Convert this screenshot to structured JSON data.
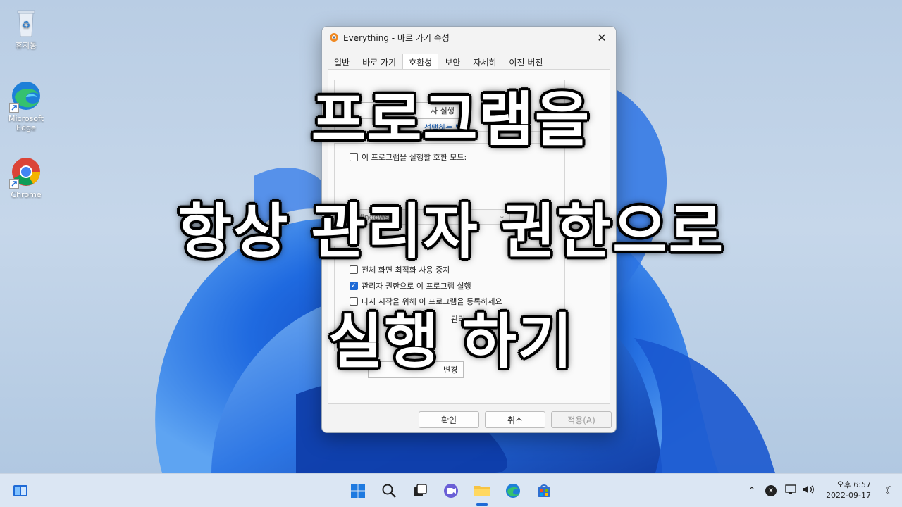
{
  "desktop": {
    "icons": [
      {
        "label": "휴지통",
        "icon": "recycle-bin-icon"
      },
      {
        "label": "Microsoft Edge",
        "icon": "edge-icon"
      },
      {
        "label": "Chrome",
        "icon": "chrome-icon"
      }
    ]
  },
  "dialog": {
    "title": "Everything - 바로 가기 속성",
    "tabs": [
      "일반",
      "바로 가기",
      "호환성",
      "보안",
      "자세히",
      "이전 버전"
    ],
    "active_tab": "호환성",
    "compat_button_fragment": "사 실행",
    "compat_link_fragment": "선택하는 방",
    "compat_mode_checkbox": "이 프로그램을 실행할 호환 모드:",
    "compat_mode_select": "Windows 8",
    "fullscreen_checkbox": "전체 화면 최적화 사용 중지",
    "admin_checkbox": "관리자 권한으로 이 프로그램 실행",
    "register_checkbox_fragment": "다시 시작을 위해 이 프로그램을 등록하세요",
    "management_fragment": "관리",
    "change_button_fragment": "변경",
    "buttons": {
      "ok": "확인",
      "cancel": "취소",
      "apply": "적용(A)"
    }
  },
  "caption": {
    "line1": "프로그램을",
    "line2": "항상 관리자 권한으로",
    "line3": "실행 하기"
  },
  "taskbar": {
    "apps": [
      "start-icon",
      "search-icon",
      "task-view-icon",
      "chat-icon",
      "file-explorer-icon",
      "edge-icon",
      "store-icon"
    ],
    "clock_time": "오후 6:57",
    "clock_date": "2022-09-17"
  },
  "colors": {
    "accent": "#1e6ad6",
    "wallpaper_blue": "#1f5fd6"
  }
}
